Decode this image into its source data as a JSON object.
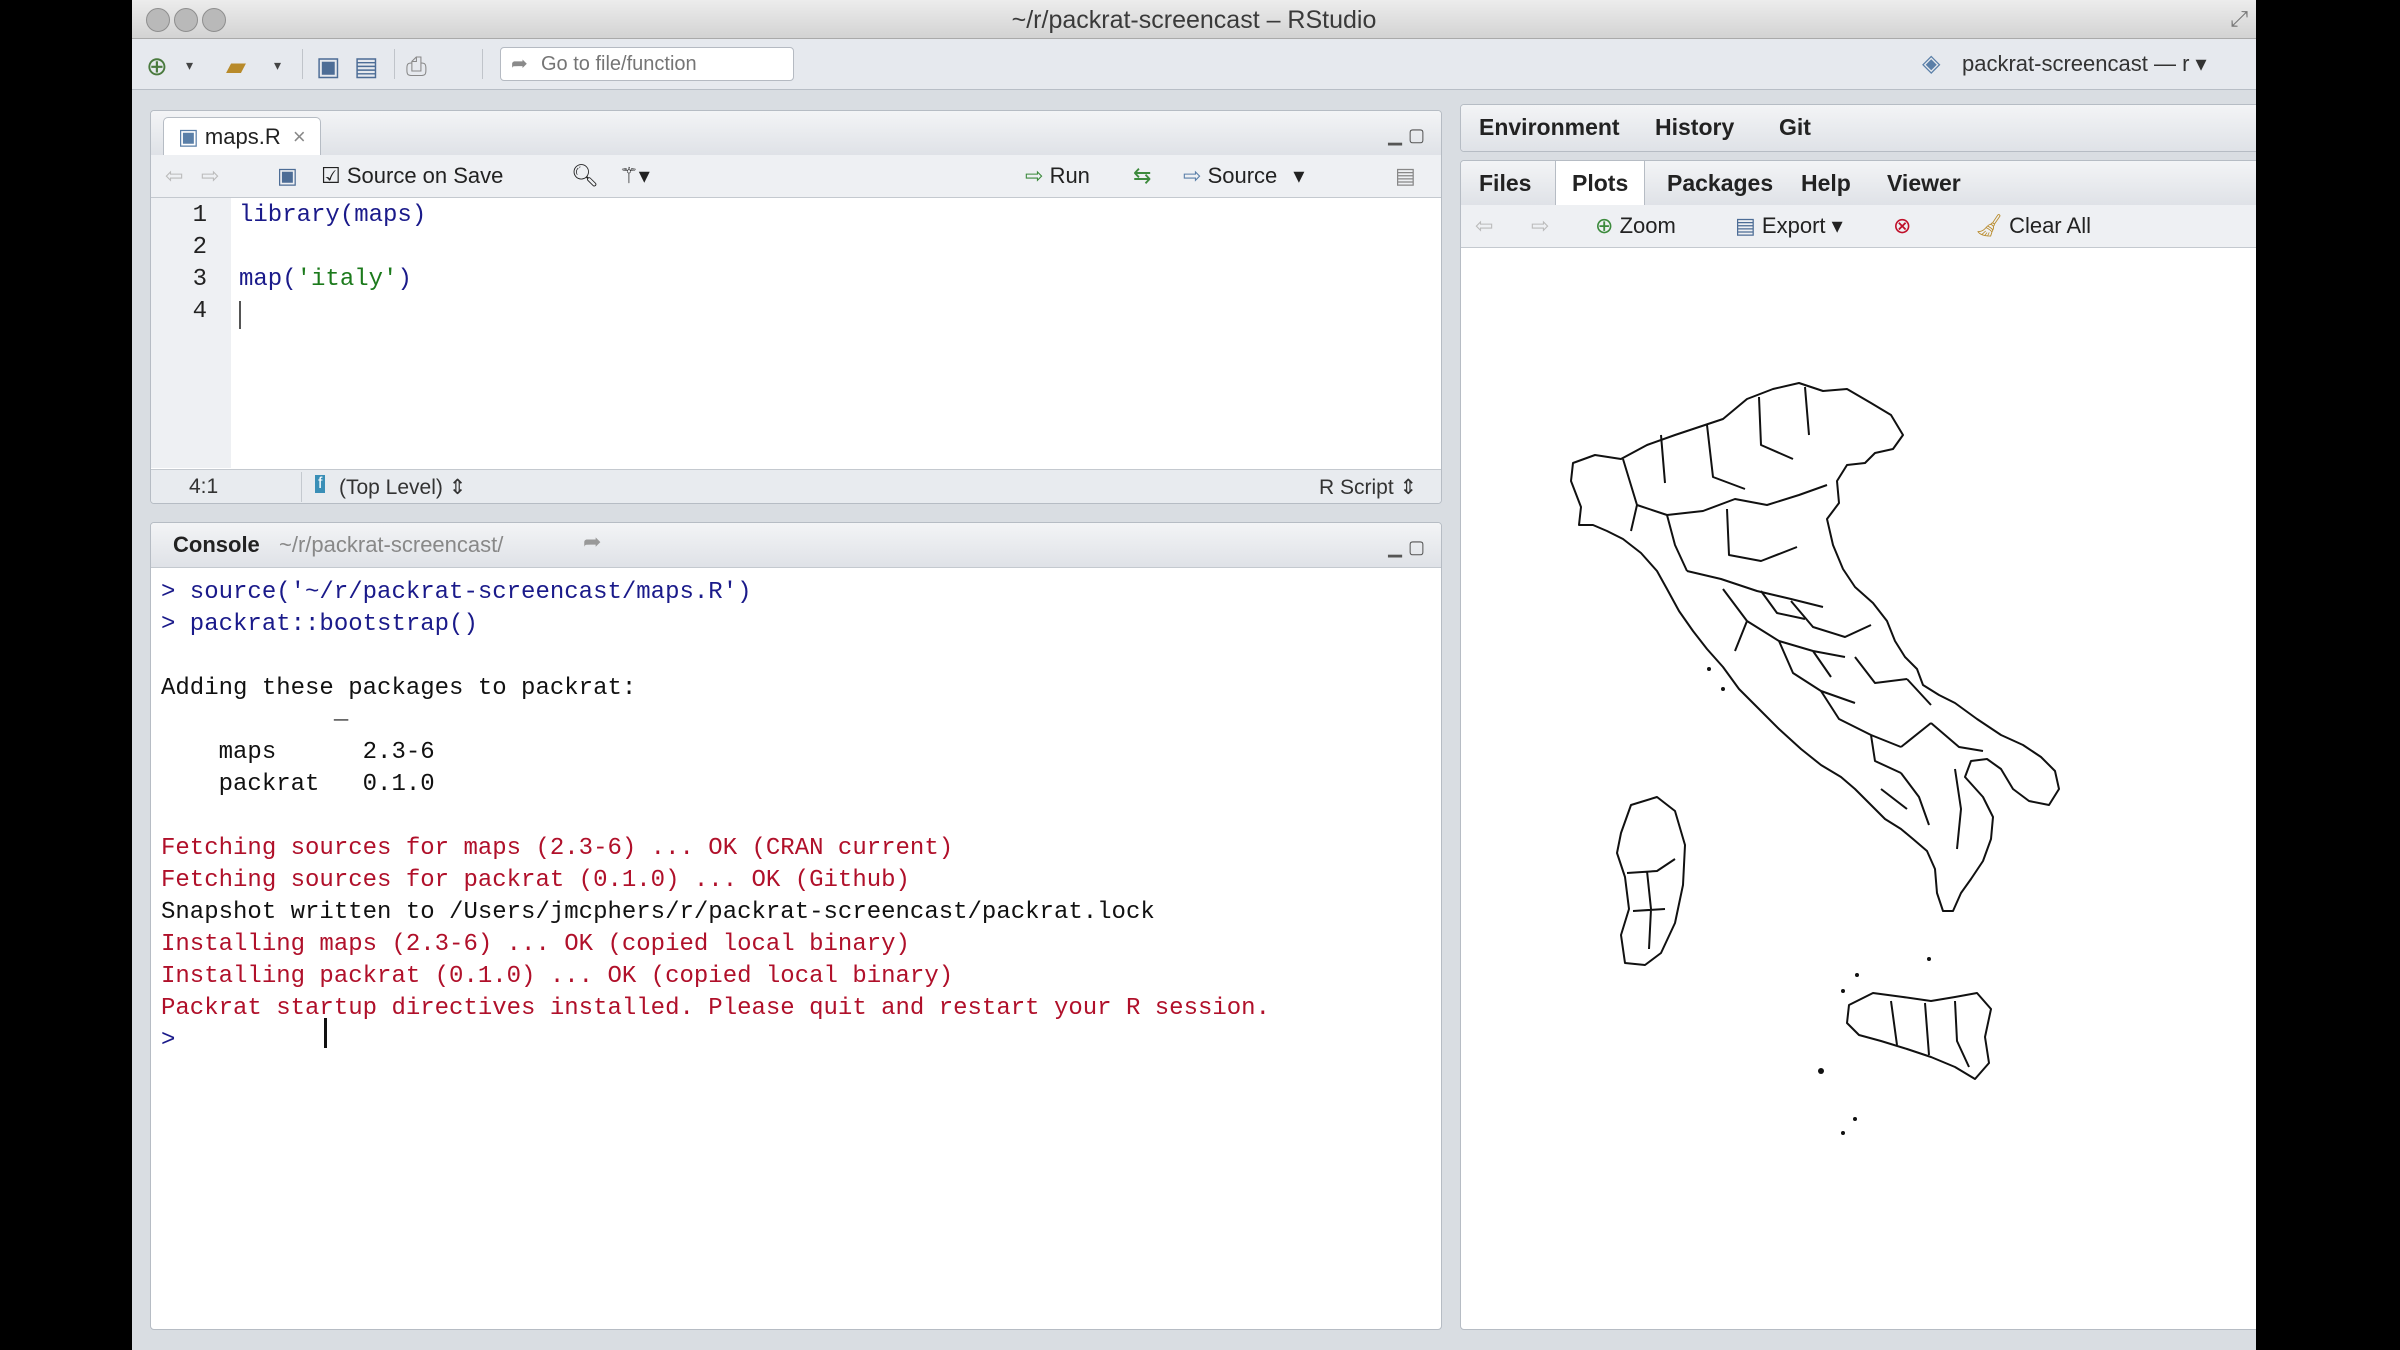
{
  "window": {
    "title": "~/r/packrat-screencast – RStudio"
  },
  "toolbar": {
    "goto_placeholder": "Go to file/function",
    "project_label": "packrat-screencast — r ▾"
  },
  "editor": {
    "tab_label": "maps.R",
    "source_on_save": "Source on Save",
    "run_label": "Run",
    "source_label": "Source",
    "line_numbers": [
      "1",
      "2",
      "3",
      "4"
    ],
    "lines": [
      "library(maps)",
      "",
      "map('italy')",
      ""
    ],
    "status": {
      "position": "4:1",
      "scope": "(Top Level)",
      "filetype": "R Script"
    }
  },
  "console": {
    "title": "Console",
    "path": "~/r/packrat-screencast/",
    "lines": [
      {
        "kind": "cmd",
        "text": "> source('~/r/packrat-screencast/maps.R')"
      },
      {
        "kind": "cmd",
        "text": "> packrat::bootstrap()"
      },
      {
        "kind": "out",
        "text": ""
      },
      {
        "kind": "out",
        "text": "Adding these packages to packrat:"
      },
      {
        "kind": "out",
        "text": "            _"
      },
      {
        "kind": "out",
        "text": "    maps      2.3-6"
      },
      {
        "kind": "out",
        "text": "    packrat   0.1.0"
      },
      {
        "kind": "out",
        "text": ""
      },
      {
        "kind": "msg",
        "text": "Fetching sources for maps (2.3-6) ... OK (CRAN current)"
      },
      {
        "kind": "msg",
        "text": "Fetching sources for packrat (0.1.0) ... OK (Github)"
      },
      {
        "kind": "out",
        "text": "Snapshot written to /Users/jmcphers/r/packrat-screencast/packrat.lock"
      },
      {
        "kind": "msg",
        "text": "Installing maps (2.3-6) ... OK (copied local binary)"
      },
      {
        "kind": "msg",
        "text": "Installing packrat (0.1.0) ... OK (copied local binary)"
      },
      {
        "kind": "msg",
        "text": "Packrat startup directives installed. Please quit and restart your R session."
      },
      {
        "kind": "cmd",
        "text": ">"
      }
    ]
  },
  "env_tabs": [
    "Environment",
    "History",
    "Git"
  ],
  "plots_pane": {
    "tabs": [
      "Files",
      "Plots",
      "Packages",
      "Help",
      "Viewer"
    ],
    "active_tab": "Plots",
    "zoom_label": "Zoom",
    "export_label": "Export",
    "clear_label": "Clear All"
  },
  "colors": {
    "command": "#1a1a8a",
    "message": "#b0102a",
    "output": "#111111"
  }
}
